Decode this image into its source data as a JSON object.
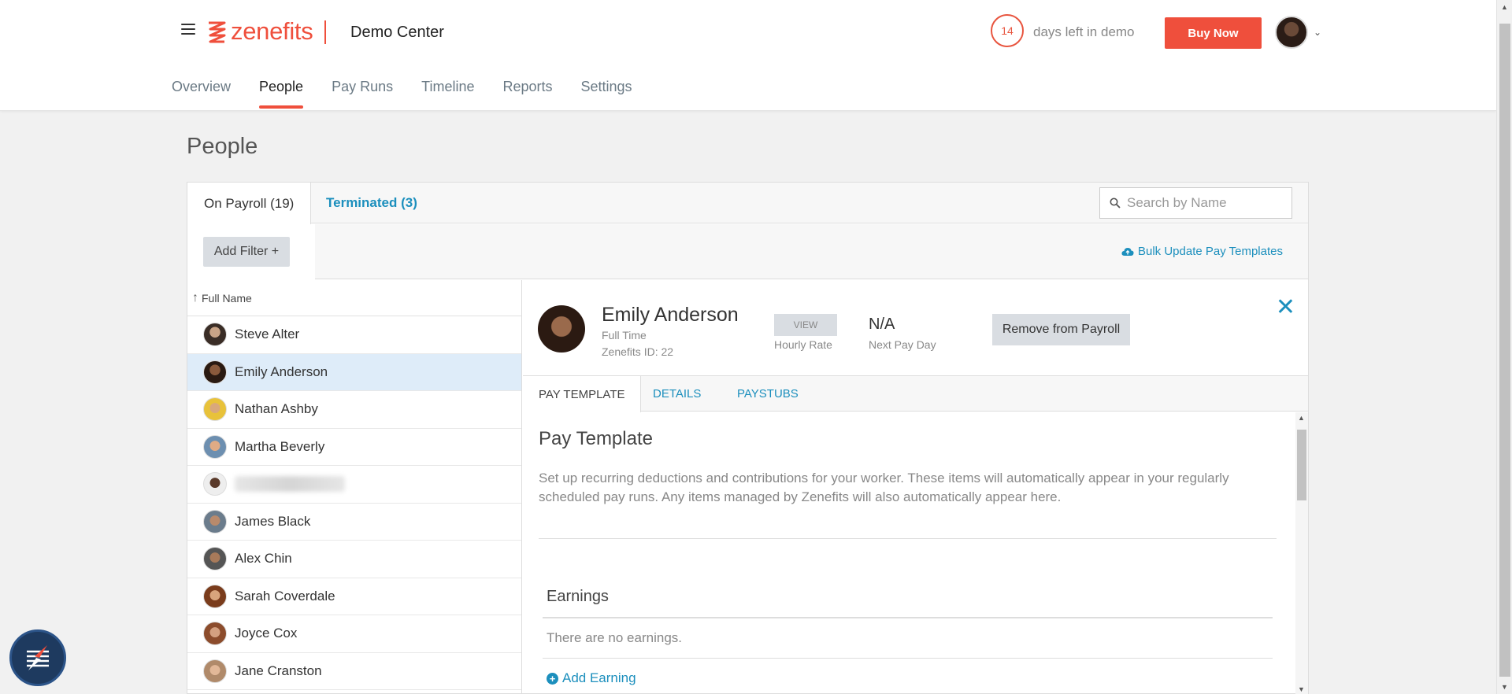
{
  "header": {
    "logo_text": "zenefits",
    "app_title": "Demo Center",
    "demo_days": "14",
    "demo_text": "days left in demo",
    "buy_label": "Buy Now",
    "brand_color": "#ef4f3c"
  },
  "nav": {
    "items": [
      {
        "label": "Overview"
      },
      {
        "label": "People"
      },
      {
        "label": "Pay Runs"
      },
      {
        "label": "Timeline"
      },
      {
        "label": "Reports"
      },
      {
        "label": "Settings"
      }
    ],
    "active": "People"
  },
  "page": {
    "title": "People"
  },
  "tabs": {
    "on_payroll": "On Payroll (19)",
    "terminated": "Terminated (3)"
  },
  "search": {
    "placeholder": "Search by Name"
  },
  "filters": {
    "add_filter": "Add Filter +",
    "bulk_update": "Bulk Update Pay Templates"
  },
  "list": {
    "header": "Full Name",
    "rows": [
      {
        "name": "Steve Alter"
      },
      {
        "name": "Emily Anderson",
        "selected": true
      },
      {
        "name": "Nathan Ashby"
      },
      {
        "name": "Martha Beverly"
      },
      {
        "name": "",
        "blurred": true
      },
      {
        "name": "James Black"
      },
      {
        "name": "Alex Chin"
      },
      {
        "name": "Sarah Coverdale"
      },
      {
        "name": "Joyce Cox"
      },
      {
        "name": "Jane Cranston"
      }
    ]
  },
  "detail": {
    "name": "Emily Anderson",
    "employment": "Full Time",
    "zenefits_id": "Zenefits ID: 22",
    "view_label": "VIEW",
    "hourly_rate_label": "Hourly Rate",
    "next_pay_value": "N/A",
    "next_pay_label": "Next Pay Day",
    "remove_label": "Remove from Payroll",
    "close_glyph": "✕",
    "tabs": [
      "PAY TEMPLATE",
      "DETAILS",
      "PAYSTUBS"
    ]
  },
  "pay_template": {
    "title": "Pay Template",
    "description": "Set up recurring deductions and contributions for your worker. These items will automatically appear in your regularly scheduled pay runs. Any items managed by Zenefits will also automatically appear here.",
    "earnings_title": "Earnings",
    "no_earnings": "There are no earnings.",
    "add_earning": "Add Earning"
  }
}
